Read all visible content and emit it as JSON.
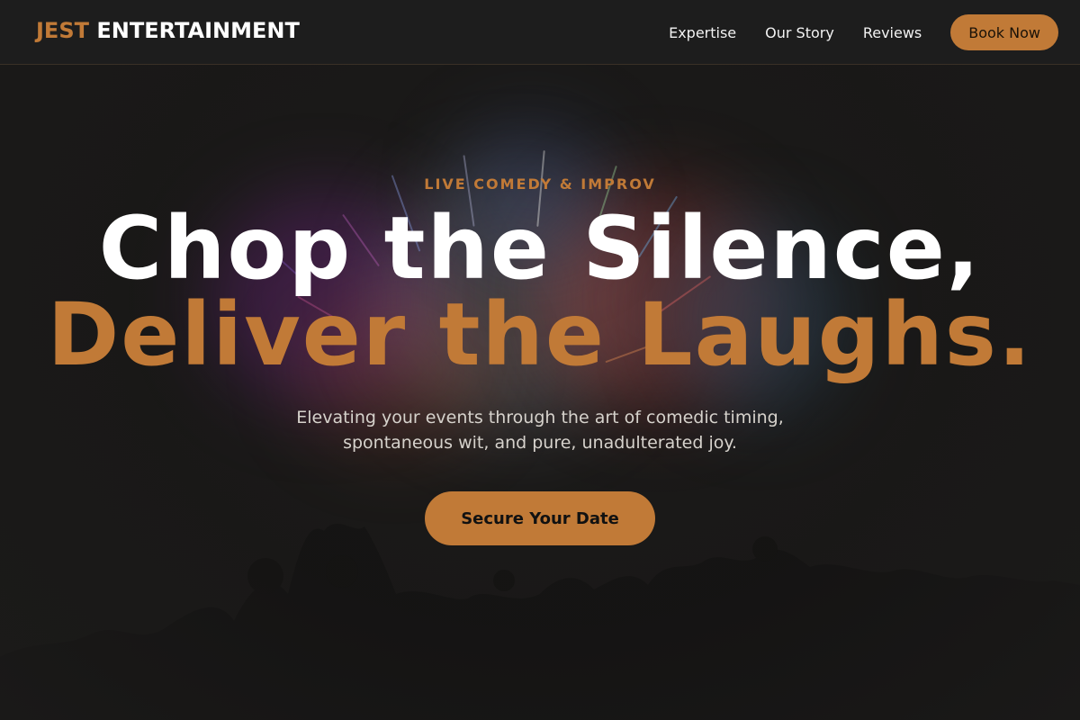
{
  "brand": {
    "logo_accent": "JEST",
    "logo_main": "ENTERTAINMENT"
  },
  "nav": {
    "items": [
      {
        "label": "Expertise"
      },
      {
        "label": "Our Story"
      },
      {
        "label": "Reviews"
      }
    ],
    "cta_label": "Book Now"
  },
  "hero": {
    "eyebrow": "LIVE COMEDY & IMPROV",
    "headline_line1": "Chop the Silence,",
    "headline_line2": "Deliver the Laughs.",
    "subtitle": "Elevating your events through the art of comedic timing, spontaneous wit, and pure, unadulterated joy.",
    "cta_label": "Secure Your Date"
  },
  "colors": {
    "accent": "#c17a37",
    "background": "#1b1a19",
    "header_background": "#1d1d1d",
    "headline_primary": "#ffffff"
  }
}
